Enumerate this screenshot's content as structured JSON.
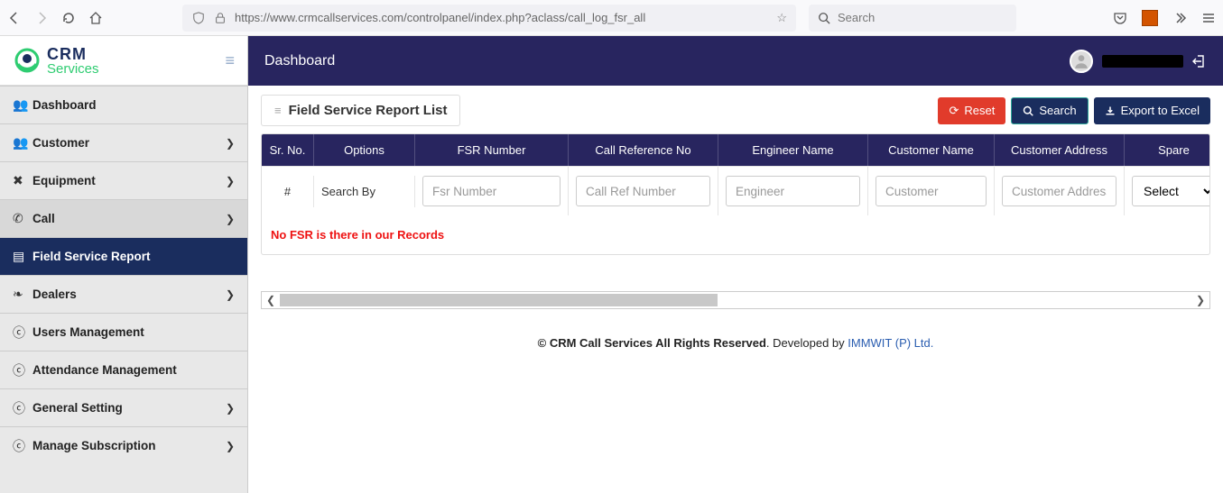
{
  "browser": {
    "url": "https://www.crmcallservices.com/controlpanel/index.php?aclass/call_log_fsr_all",
    "search_placeholder": "Search"
  },
  "logo": {
    "top": "CRM",
    "bottom": "Services"
  },
  "sidebar": {
    "items": [
      {
        "label": "Dashboard",
        "expandable": false,
        "active": false
      },
      {
        "label": "Customer",
        "expandable": true,
        "active": false
      },
      {
        "label": "Equipment",
        "expandable": true,
        "active": false
      },
      {
        "label": "Call",
        "expandable": true,
        "active": false
      },
      {
        "label": "Field Service Report",
        "expandable": false,
        "active": true
      },
      {
        "label": "Dealers",
        "expandable": true,
        "active": false
      },
      {
        "label": "Users Management",
        "expandable": false,
        "active": false
      },
      {
        "label": "Attendance Management",
        "expandable": false,
        "active": false
      },
      {
        "label": "General Setting",
        "expandable": true,
        "active": false
      },
      {
        "label": "Manage Subscription",
        "expandable": true,
        "active": false
      }
    ]
  },
  "header": {
    "title": "Dashboard"
  },
  "panel": {
    "title": "Field Service Report List",
    "buttons": {
      "reset": "Reset",
      "search": "Search",
      "export": "Export to Excel"
    }
  },
  "table": {
    "columns": [
      "Sr. No.",
      "Options",
      "FSR Number",
      "Call Reference No",
      "Engineer Name",
      "Customer Name",
      "Customer Address",
      "Spare"
    ],
    "filter_row": {
      "sr": "#",
      "options_label": "Search By",
      "placeholders": {
        "fsr": "Fsr Number",
        "ref": "Call Ref Number",
        "eng": "Engineer",
        "cust": "Customer",
        "addr": "Customer Address"
      },
      "spare_select": "Select"
    },
    "empty_message": "No FSR is there in our Records"
  },
  "footer": {
    "copyright": "© CRM Call Services All Rights Reserved",
    "dev_prefix": ". Developed by ",
    "dev_link": "IMMWIT (P) Ltd."
  }
}
